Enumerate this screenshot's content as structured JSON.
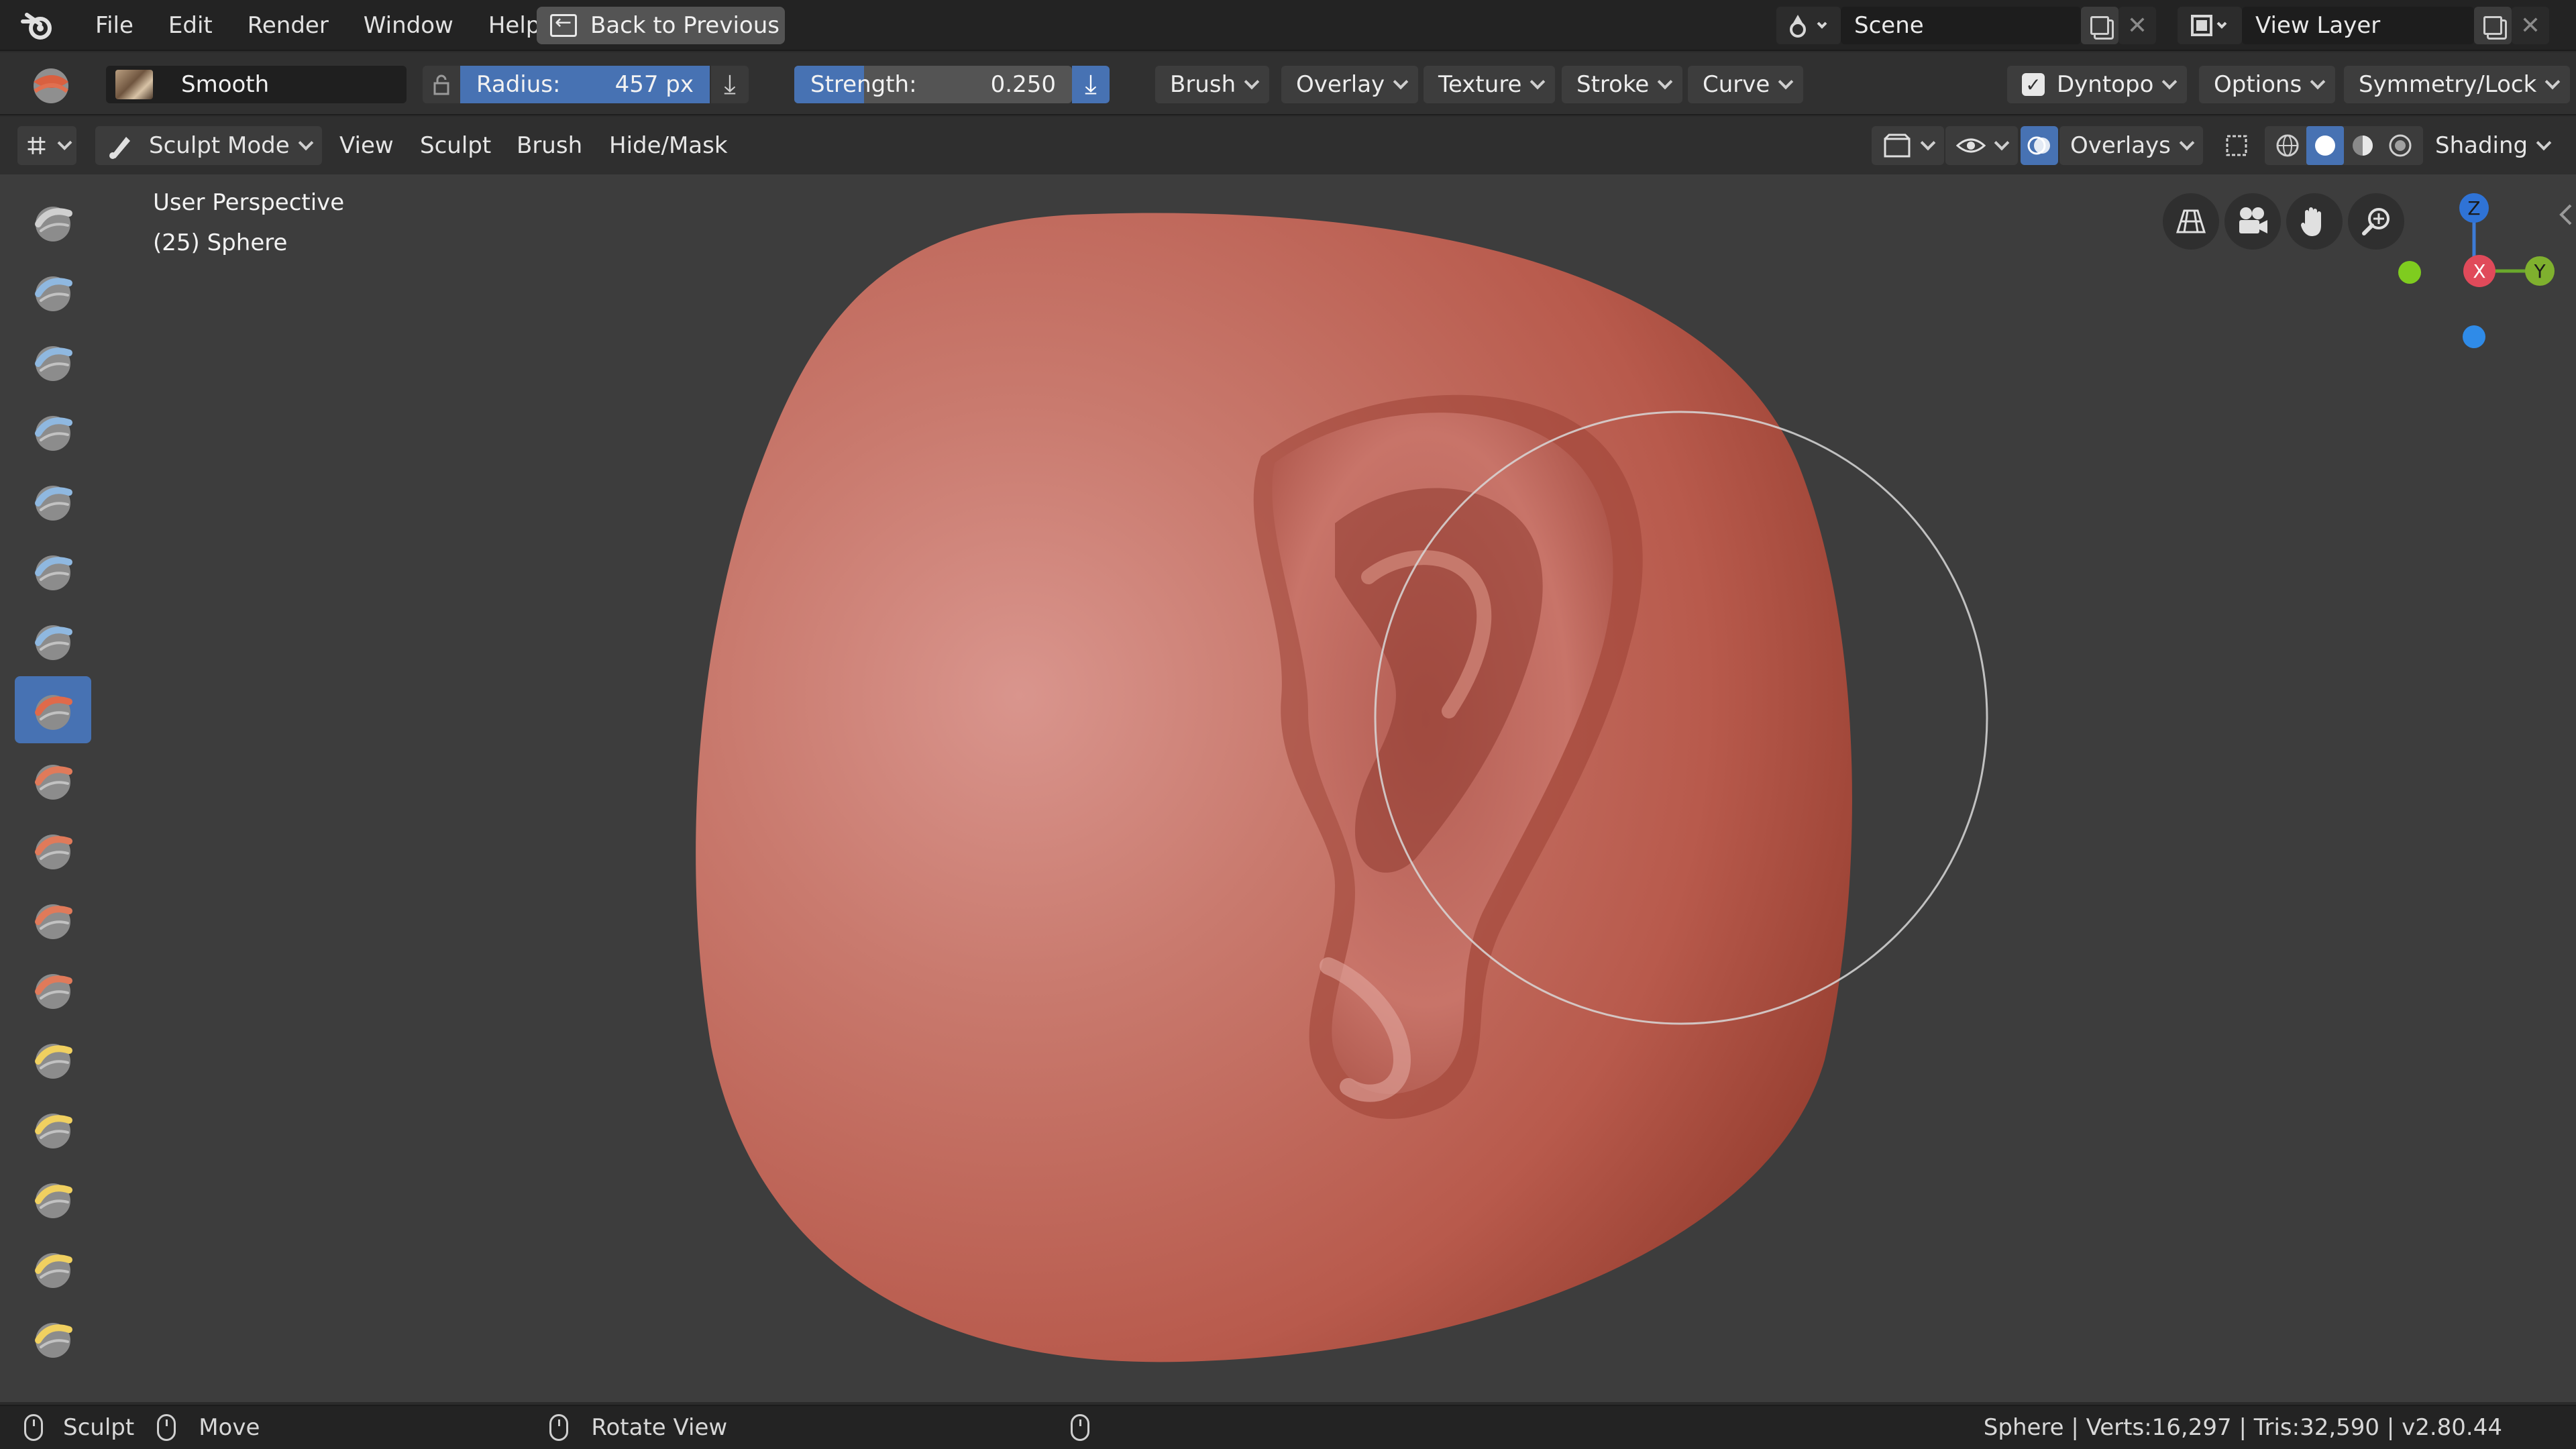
{
  "topbar": {
    "menus": [
      "File",
      "Edit",
      "Render",
      "Window",
      "Help"
    ],
    "back_label": "Back to Previous",
    "scene": "Scene",
    "view_layer": "View Layer"
  },
  "toolheader": {
    "brush_name": "Smooth",
    "radius_label": "Radius:",
    "radius_value": "457 px",
    "strength_label": "Strength:",
    "strength_value": "0.250",
    "strength_fraction": 0.25,
    "menus": [
      "Brush",
      "Overlay",
      "Texture",
      "Stroke",
      "Curve"
    ],
    "dyntopo": "Dyntopo",
    "options": "Options",
    "symmetry": "Symmetry/Lock"
  },
  "vpheader": {
    "mode": "Sculpt Mode",
    "menus": [
      "View",
      "Sculpt",
      "Brush",
      "Hide/Mask"
    ],
    "overlays": "Overlays",
    "shading": "Shading"
  },
  "viewport": {
    "perspective": "User Perspective",
    "object": "(25) Sphere",
    "gizmo": {
      "z": "Z",
      "x": "X",
      "y": "Y"
    }
  },
  "tools": [
    "draw",
    "clay",
    "clay-strips",
    "layer",
    "inflate",
    "blob",
    "crease",
    "smooth",
    "flatten",
    "fill",
    "scrape",
    "pinch",
    "grab",
    "snake-hook",
    "thumb",
    "nudge",
    "rotate"
  ],
  "active_tool_index": 7,
  "statusbar": {
    "sculpt": "Sculpt",
    "move": "Move",
    "rotate": "Rotate View",
    "info": "Sphere | Verts:16,297 | Tris:32,590 | v2.80.44"
  },
  "colors": {
    "accent": "#4772b3",
    "mesh": "#b85a4c"
  }
}
